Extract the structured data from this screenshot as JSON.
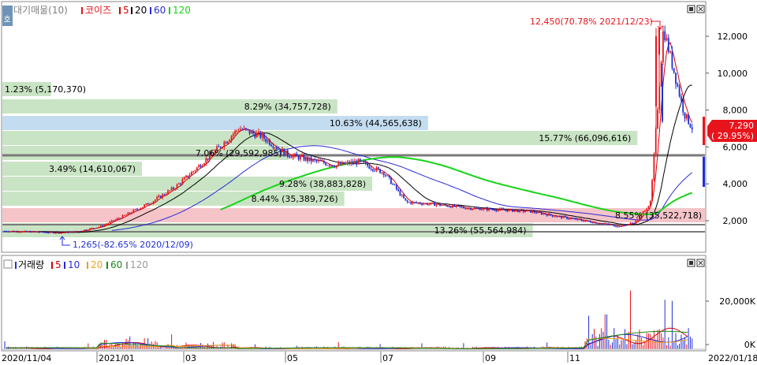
{
  "legend_price": {
    "flag": "호",
    "label": "대기매물(10)",
    "series_label": "코이즈",
    "ma5": "5",
    "ma20": "20",
    "ma60": "60",
    "ma120": "120"
  },
  "legend_volume": {
    "label": "거래량",
    "ma5": "5",
    "ma10": "10",
    "ma20": "20",
    "ma60": "60",
    "ma120": "120"
  },
  "colors": {
    "up": "#e8141c",
    "down": "#1e2fd6",
    "ma5": "#d40000",
    "ma20": "#000000",
    "ma60": "#2a2ad8",
    "ma120": "#17d417",
    "bar_green": "#c9e4c4",
    "bar_blue": "#c3dcf0",
    "bar_pink": "#f4c4c8",
    "current_box": "#e8141c"
  },
  "price_axis": {
    "ticks": [
      "12,000",
      "10,000",
      "8,000",
      "6,000",
      "4,000",
      "2,000"
    ]
  },
  "volume_axis": {
    "ticks": [
      "20,000K",
      "0K"
    ]
  },
  "x_axis": {
    "labels": [
      "2020/11/04",
      "2021/01",
      "03",
      "05",
      "07",
      "09",
      "11",
      "2022/01/18"
    ]
  },
  "annotations": {
    "high": "12,450(70.78% 2021/12/23)",
    "low": "1,265(-82.65% 2020/12/09)",
    "current_price": "7,290",
    "current_pct": "( 29.95%)"
  },
  "chart_data": {
    "type": "candlestick",
    "x_range": [
      "2020/11/04",
      "2022/01/18"
    ],
    "price_ylim": [
      1000,
      13000
    ],
    "price_levels": [
      {
        "label": "1.23% (5,170,370)",
        "price": 7000,
        "share": 0.07
      },
      {
        "label": "8.29% (34,757,728)",
        "price": 6600,
        "share": 0.48
      },
      {
        "label": "10.63% (44,565,638)",
        "price": 6200,
        "share": 0.61
      },
      {
        "label": "15.77% (66,096,616)",
        "price": 5800,
        "share": 0.91
      },
      {
        "label": "7.06% (29,592,985)",
        "price": 5400,
        "share": 0.41
      },
      {
        "label": "3.49% (14,610,067)",
        "price": 5000,
        "share": 0.2
      },
      {
        "label": "9.28% (38,883,828)",
        "price": 4400,
        "share": 0.53
      },
      {
        "label": "8.44% (35,389,726)",
        "price": 3900,
        "share": 0.49
      },
      {
        "label": "8.55% (35,522,718)",
        "price": 2500,
        "share": 1.0
      },
      {
        "label": "13.26% (55,564,984)",
        "price": 1700,
        "share": 0.76
      }
    ],
    "close_path": [
      [
        "2020/11/04",
        1450
      ],
      [
        "2020/12/09",
        1350
      ],
      [
        "2020/12/20",
        1400
      ],
      [
        "2021/01/05",
        1700
      ],
      [
        "2021/01/20",
        2300
      ],
      [
        "2021/02/05",
        3000
      ],
      [
        "2021/02/20",
        3800
      ],
      [
        "2021/03/05",
        4800
      ],
      [
        "2021/03/20",
        6000
      ],
      [
        "2021/04/01",
        7000
      ],
      [
        "2021/04/15",
        6600
      ],
      [
        "2021/05/01",
        5600
      ],
      [
        "2021/05/15",
        5300
      ],
      [
        "2021/06/01",
        5000
      ],
      [
        "2021/06/15",
        5200
      ],
      [
        "2021/07/01",
        4600
      ],
      [
        "2021/07/15",
        3000
      ],
      [
        "2021/08/01",
        2900
      ],
      [
        "2021/08/20",
        2700
      ],
      [
        "2021/09/10",
        2600
      ],
      [
        "2021/10/01",
        2500
      ],
      [
        "2021/10/20",
        2200
      ],
      [
        "2021/11/10",
        1900
      ],
      [
        "2021/11/25",
        1700
      ],
      [
        "2021/12/05",
        1900
      ],
      [
        "2021/12/15",
        3000
      ],
      [
        "2021/12/23",
        12450
      ],
      [
        "2022/01/05",
        7800
      ],
      [
        "2022/01/18",
        5800
      ]
    ],
    "volume_ylim": [
      0,
      30000
    ],
    "volume_unit": "K"
  }
}
